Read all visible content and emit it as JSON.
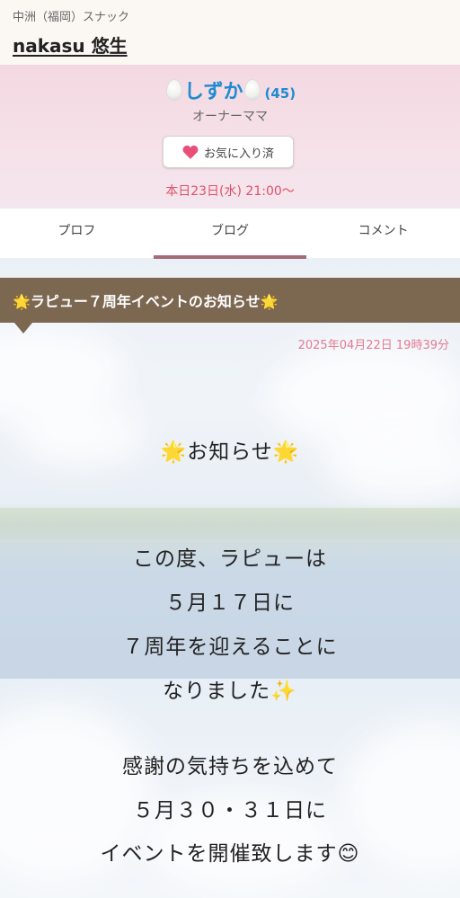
{
  "header": {
    "area": "中洲（福岡）スナック",
    "shop_name": "nakasu 悠生"
  },
  "profile": {
    "name": "しずか",
    "age": "(45)",
    "role": "オーナーママ",
    "favorite_label": "お気に入り済",
    "schedule": "本日23日(水) 21:00〜"
  },
  "tabs": [
    {
      "label": "プロフ"
    },
    {
      "label": "ブログ"
    },
    {
      "label": "コメント"
    }
  ],
  "active_tab": "ブログ",
  "blog": {
    "title": "🌟ラピュー７周年イベントのお知らせ🌟",
    "date": "2025年04月22日 19時39分",
    "lines": [
      "🌟お知らせ🌟",
      "この度、ラピューは",
      "５月１７日に",
      "７周年を迎えることに",
      "なりました✨",
      "感謝の気持ちを込めて",
      "５月３０・３１日に",
      "イベントを開催致します😊"
    ]
  },
  "colors": {
    "name": "#1f8bd0",
    "accent": "#e0506a",
    "title_bar": "#7c6751",
    "tab_indicator": "#a26d78"
  },
  "icons": {
    "favorite": "heart-icon",
    "name_decoration": "egg-icon"
  }
}
